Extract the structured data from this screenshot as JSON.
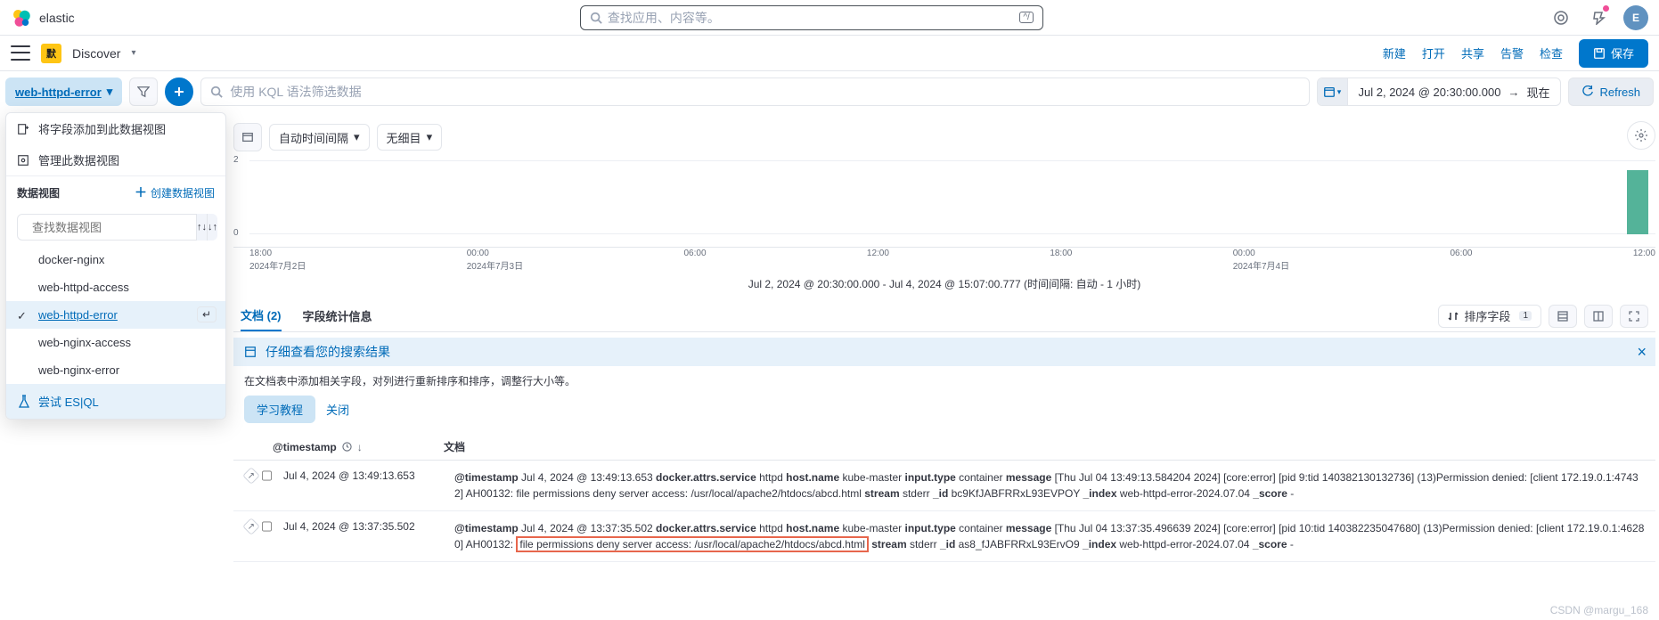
{
  "header": {
    "brand": "elastic",
    "search_placeholder": "查找应用、内容等。",
    "avatar_letter": "E"
  },
  "toolbar": {
    "badge": "默",
    "breadcrumb": "Discover",
    "links": {
      "new": "新建",
      "open": "打开",
      "share": "共享",
      "alerts": "告警",
      "inspect": "检查"
    },
    "save_label": "保存"
  },
  "query": {
    "dataview_label": "web-httpd-error",
    "kql_placeholder": "使用 KQL 语法筛选数据",
    "date_start": "Jul 2, 2024 @ 20:30:00.000",
    "date_end": "现在",
    "refresh_label": "Refresh"
  },
  "popover": {
    "add_field": "将字段添加到此数据视图",
    "manage": "管理此数据视图",
    "section_title": "数据视图",
    "create_link": "创建数据视图",
    "search_placeholder": "查找数据视图",
    "items": [
      "docker-nginx",
      "web-httpd-access",
      "web-httpd-error",
      "web-nginx-access",
      "web-nginx-error"
    ],
    "selected_idx": 2,
    "footer": "尝试 ES|QL"
  },
  "chart": {
    "auto_interval": "自动时间间隔",
    "breakdown_none": "无细目",
    "summary": "Jul 2, 2024 @ 20:30:00.000 - Jul 4, 2024 @ 15:07:00.777   (时间间隔: 自动 - 1 小时)",
    "xticks": [
      {
        "time": "18:00",
        "date": "2024年7月2日"
      },
      {
        "time": "00:00",
        "date": "2024年7月3日"
      },
      {
        "time": "06:00",
        "date": ""
      },
      {
        "time": "12:00",
        "date": ""
      },
      {
        "time": "18:00",
        "date": ""
      },
      {
        "time": "00:00",
        "date": "2024年7月4日"
      },
      {
        "time": "06:00",
        "date": ""
      },
      {
        "time": "12:00",
        "date": ""
      }
    ]
  },
  "chart_data": {
    "type": "bar",
    "xlabel": "",
    "ylabel": "",
    "ylim": [
      0,
      2
    ],
    "categories_window": "2024-07-02T18:00 .. 2024-07-04T14:00",
    "bars": [
      {
        "hour": "2024-07-04T13:00",
        "count": 2
      }
    ]
  },
  "tabs": {
    "docs": "文档 (2)",
    "stats": "字段统计信息",
    "sort_label": "排序字段",
    "sort_count": "1"
  },
  "hint": {
    "title": "仔细查看您的搜索结果",
    "subtitle": "在文档表中添加相关字段，对列进行重新排序和排序，调整行大小等。",
    "learn": "学习教程",
    "close": "关闭"
  },
  "table": {
    "timestamp_col": "@timestamp",
    "doc_col": "文档",
    "rows": [
      {
        "time": "Jul 4, 2024 @ 13:49:13.653",
        "fields": {
          "timestamp": "Jul 4, 2024 @ 13:49:13.653",
          "service": "httpd",
          "host": "kube-master",
          "input_type": "container",
          "message": "[Thu Jul 04 13:49:13.584204 2024] [core:error] [pid 9:tid 140382130132736] (13)Permission denied: [client 172.19.0.1:47432] AH00132: file permissions deny server access: /usr/local/apache2/htdocs/abcd.html",
          "stream": "stderr",
          "id": "bc9KfJABFRRxL93EVPOY",
          "index": "web-httpd-error-2024.07.04",
          "score": "-"
        }
      },
      {
        "time": "Jul 4, 2024 @ 13:37:35.502",
        "fields": {
          "timestamp": "Jul 4, 2024 @ 13:37:35.502",
          "service": "httpd",
          "host": "kube-master",
          "input_type": "container",
          "msg_pre": "[Thu Jul 04 13:37:35.496639 2024] [core:error] [pid 10:tid 140382235047680] (13)Permission denied: [client 172.19.0.1:46280] AH00132: ",
          "msg_box": "file permissions deny server access: /usr/local/apache2/htdocs/abcd.html",
          "stream": "stderr",
          "id": "as8_fJABFRRxL93ErvO9",
          "index": "web-httpd-error-2024.07.04",
          "score": "-"
        }
      }
    ]
  },
  "watermark": "CSDN @margu_168"
}
